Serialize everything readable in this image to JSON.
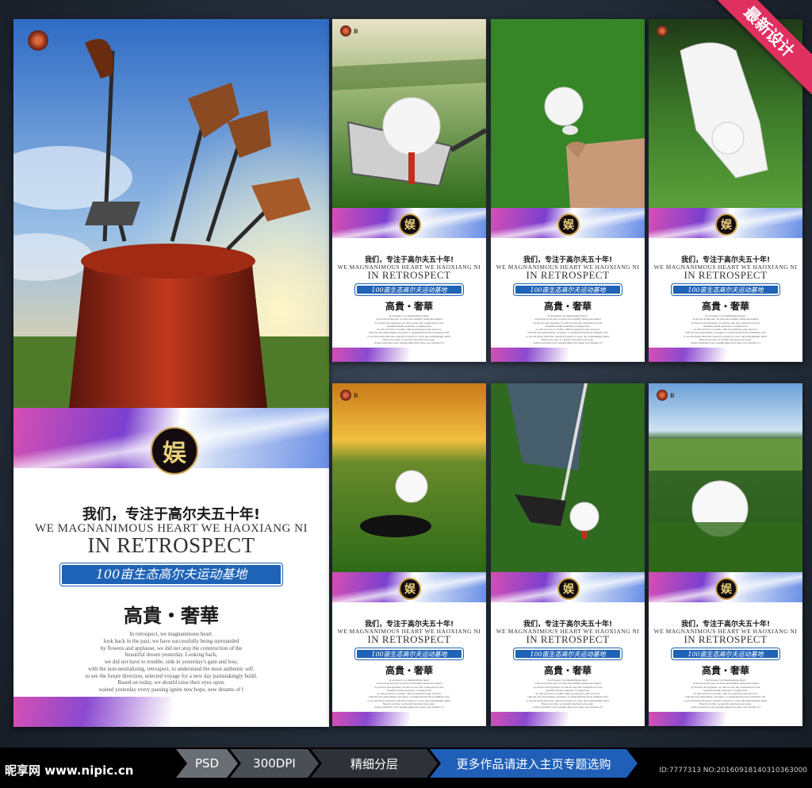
{
  "corner_label": "最新设计",
  "footer": {
    "watermark": "昵享网 www.nipic.cn",
    "chips": [
      "PSD",
      "300DPI",
      "精细分层",
      "更多作品请进入主页专题选购"
    ],
    "id_text": "ID:7777313 NO:20160918140310363000"
  },
  "poster": {
    "badge": "娱",
    "headline_cn": "我们，专注于高尔夫五十年!",
    "line_en_1": "WE MAGNANIMOUS HEART WE HAOXIANG NI",
    "line_en_2": "IN RETROSPECT",
    "ribbon": "100亩生态高尔夫运动基地",
    "tagline_cn": "高貴・奢華",
    "body_lines": [
      "In retrospect, we magnanimous heart.",
      "look back in the past, we have successfully being surrounded",
      "by flowers and applause, we did not stop the construction of the",
      "beautiful dream yesterday. Looking back,",
      "we did not have to trouble, sink in yesterday's gain and loss,",
      "with the non-neutralizing, retrospect, to understand the most authentic self.",
      "to see the future direction, selected voyage for a new day painstakingly build.",
      "Based on today, we should raise their eyes open.",
      "waited yesterday every passing ignite new hope, new dreams of f"
    ],
    "logo_text": "B"
  }
}
